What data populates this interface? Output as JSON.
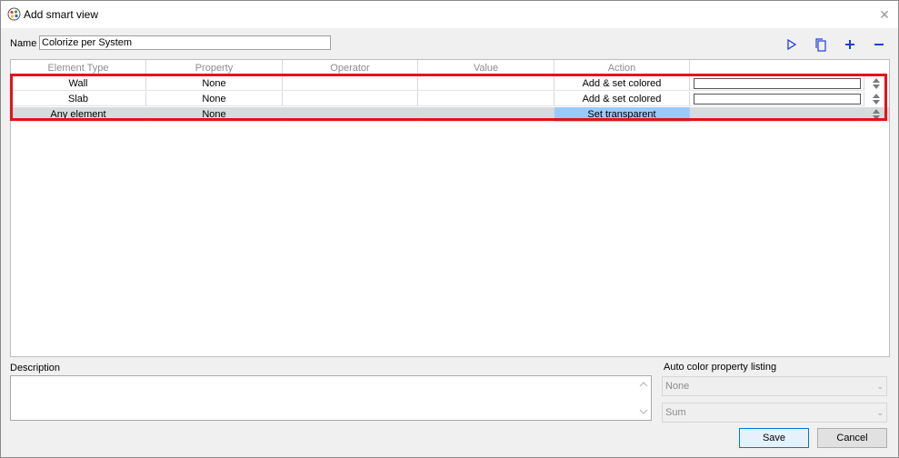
{
  "window": {
    "title": "Add smart view",
    "close_icon": "close-icon"
  },
  "name_field": {
    "label": "Name",
    "value": "Colorize per System"
  },
  "toolbar": {
    "icons": [
      "play-icon",
      "copy-icon",
      "plus-icon",
      "minus-icon"
    ],
    "accent": "#1f3fe0"
  },
  "grid": {
    "columns": [
      "Element Type",
      "Property",
      "Operator",
      "Value",
      "Action"
    ],
    "rows": [
      {
        "element_type": "Wall",
        "property": "None",
        "operator": "",
        "value": "",
        "action": "Add & set colored"
      },
      {
        "element_type": "Slab",
        "property": "None",
        "operator": "",
        "value": "",
        "action": "Add & set colored"
      },
      {
        "element_type": "Any element",
        "property": "None",
        "operator": "",
        "value": "",
        "action": "Set transparent"
      }
    ],
    "highlight_color": "#e3121b",
    "selected_color": "#99c9ff"
  },
  "description": {
    "label": "Description",
    "value": ""
  },
  "auto_color": {
    "label": "Auto color property listing",
    "property_value": "None",
    "aggregate_value": "Sum"
  },
  "buttons": {
    "save": "Save",
    "cancel": "Cancel"
  }
}
